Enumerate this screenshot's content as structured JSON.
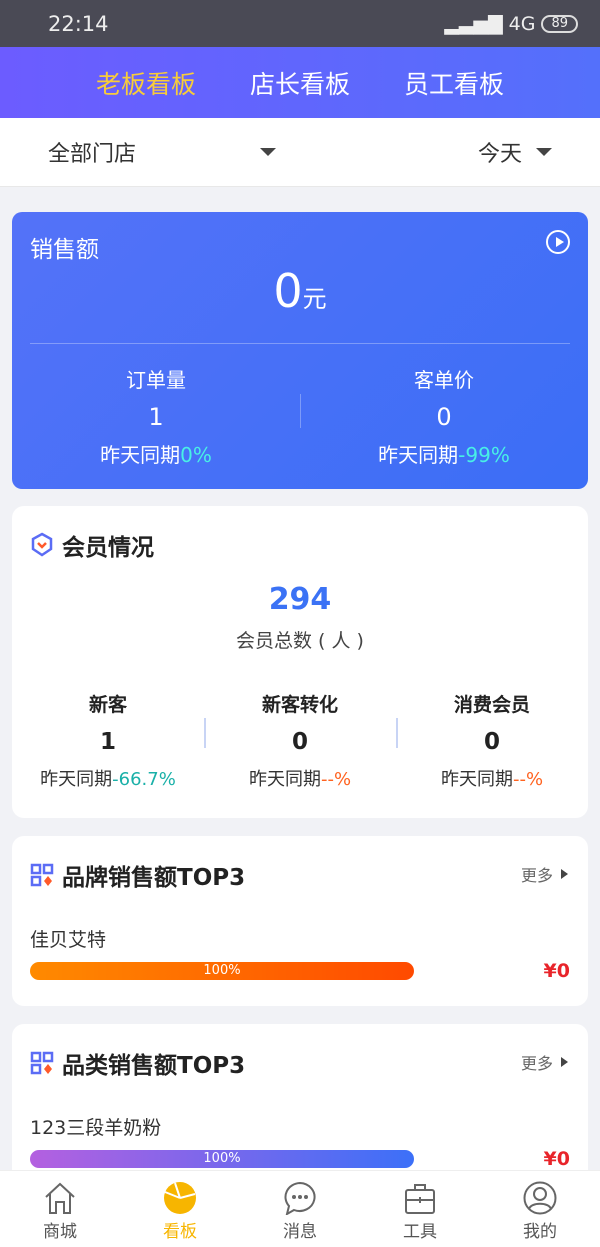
{
  "status": {
    "time": "22:14",
    "network": "4G",
    "battery": "89"
  },
  "header": {
    "tabs": [
      {
        "label": "老板看板",
        "active": true
      },
      {
        "label": "店长看板"
      },
      {
        "label": "员工看板"
      }
    ]
  },
  "filter": {
    "store": "全部门店",
    "period": "今天"
  },
  "sales": {
    "title": "销售额",
    "amount": "0",
    "unit": "元",
    "orders": {
      "label": "订单量",
      "value": "1",
      "compare_label": "昨天同期",
      "compare": "0%"
    },
    "avg": {
      "label": "客单价",
      "value": "0",
      "compare_label": "昨天同期",
      "compare": "-99%"
    }
  },
  "members": {
    "title": "会员情况",
    "total": "294",
    "total_label": "会员总数 ( 人 )",
    "cols": [
      {
        "label": "新客",
        "value": "1",
        "compare_label": "昨天同期",
        "compare": "-66.7%"
      },
      {
        "label": "新客转化",
        "value": "0",
        "compare_label": "昨天同期",
        "compare": "--%"
      },
      {
        "label": "消费会员",
        "value": "0",
        "compare_label": "昨天同期",
        "compare": "--%"
      }
    ]
  },
  "brand": {
    "title": "品牌销售额TOP3",
    "more": "更多",
    "items": [
      {
        "name": "佳贝艾特",
        "percent": "100%",
        "price": "¥0"
      }
    ]
  },
  "category": {
    "title": "品类销售额TOP3",
    "more": "更多",
    "items": [
      {
        "name": "123三段羊奶粉",
        "percent": "100%",
        "price": "¥0"
      }
    ]
  },
  "colors": {
    "accent": "#3b72f5",
    "active_tab": "#f7b500",
    "header_active": "#f8cc3a",
    "price": "#e8242a"
  },
  "tabbar": [
    {
      "label": "商城",
      "icon": "home-icon"
    },
    {
      "label": "看板",
      "icon": "pie-chart-icon",
      "active": true
    },
    {
      "label": "消息",
      "icon": "chat-icon"
    },
    {
      "label": "工具",
      "icon": "toolbox-icon"
    },
    {
      "label": "我的",
      "icon": "user-icon"
    }
  ]
}
